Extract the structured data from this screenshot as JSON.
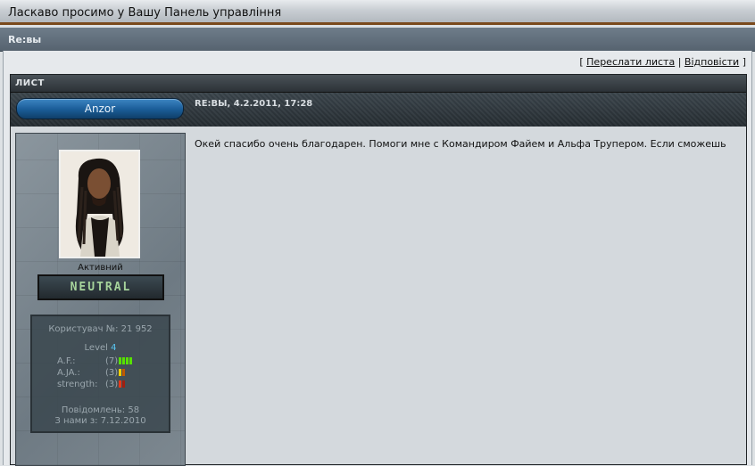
{
  "window": {
    "title": "Ласкаво просимо у Вашу Панель управління"
  },
  "subject": {
    "title": "Re:вы"
  },
  "actions": {
    "open_bracket": "[",
    "forward_label": "Переслати листа",
    "separator": "|",
    "reply_label": "Відповісти",
    "close_bracket": "]"
  },
  "panel": {
    "header": "ЛИСТ"
  },
  "post": {
    "author": "Anzor",
    "meta": "RE:ВЫ, 4.2.2011, 17:28",
    "body": "Окей спасибо очень благодарен. Помоги мне с Командиром Файем и Альфа Трупером. Если сможешь"
  },
  "profile": {
    "status": "Активний",
    "rank": "NEUTRAL",
    "user_no_label": "Користувач №: 21 952",
    "level_label": "Level",
    "level_value": "4",
    "stats": [
      {
        "label": "A.F.:",
        "value": "(7)",
        "bars": [
          "#57e000",
          "#57e000",
          "#57e000",
          "#57e000"
        ]
      },
      {
        "label": "A.JA.:",
        "value": "(3)",
        "bars": [
          "#f0d000",
          "#c05a00"
        ]
      },
      {
        "label": "strength:",
        "value": "(3)",
        "bars": [
          "#e83a1a",
          "#a02010"
        ]
      }
    ],
    "posts_label": "Повідомлень: 58",
    "since_label": "З нами з: 7.12.2010"
  }
}
